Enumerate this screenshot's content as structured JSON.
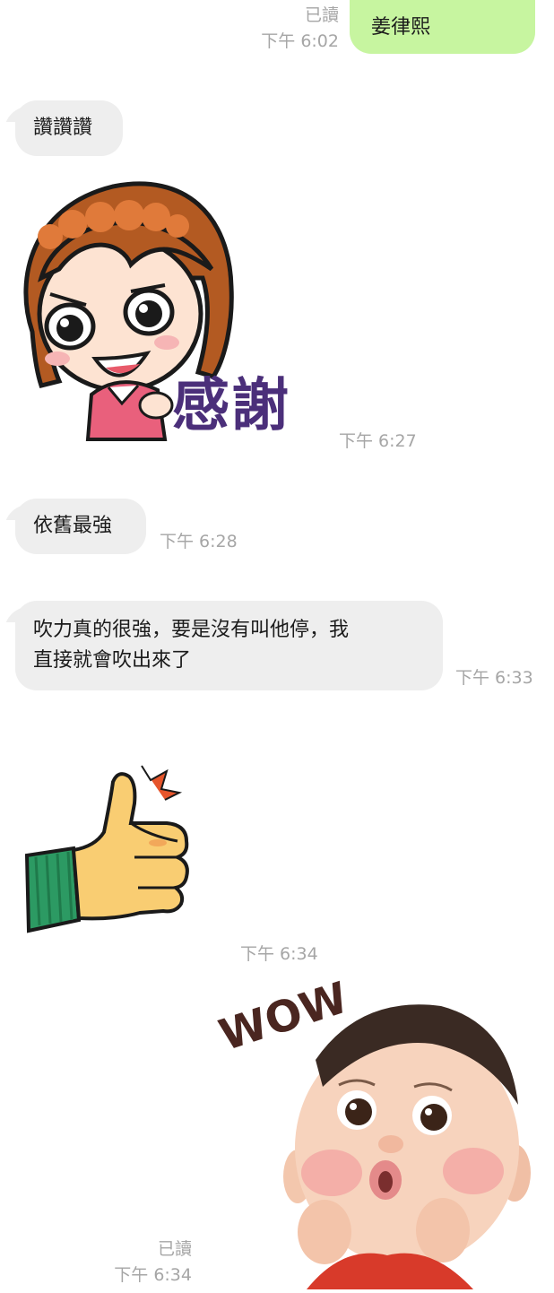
{
  "messages": [
    {
      "side": "out",
      "type": "text",
      "text": "姜律熙",
      "read": "已讀",
      "time": "下午 6:02"
    },
    {
      "side": "in",
      "type": "text",
      "text": "讚讚讚",
      "time": ""
    },
    {
      "side": "in",
      "type": "sticker",
      "sticker_name": "girl-thanks-sticker",
      "sticker_text": "感謝",
      "time": "下午 6:27"
    },
    {
      "side": "in",
      "type": "text",
      "text": "依舊最強",
      "time": "下午 6:28"
    },
    {
      "side": "in",
      "type": "text",
      "lines": [
        "吹力真的很強，要是沒有叫他停，我",
        "直接就會吹出來了"
      ],
      "time": "下午 6:33"
    },
    {
      "side": "in",
      "type": "sticker",
      "sticker_name": "thumbs-up-sticker",
      "time": "下午 6:34"
    },
    {
      "side": "out",
      "type": "sticker",
      "sticker_name": "baby-wow-sticker",
      "sticker_text": "WOW",
      "read": "已讀",
      "time": "下午 6:34"
    }
  ],
  "colors": {
    "outgoing_bubble": "#c7f5a0",
    "incoming_bubble": "#eeeeee",
    "meta_text": "#a6a6a6"
  }
}
